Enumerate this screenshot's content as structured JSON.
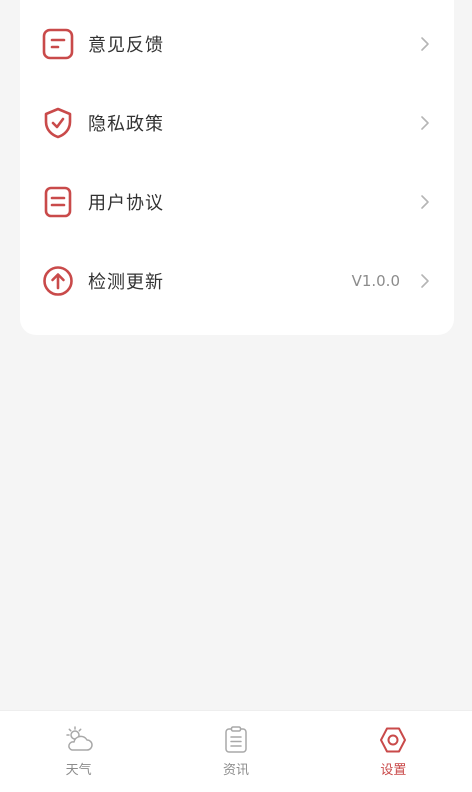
{
  "settings": {
    "items": [
      {
        "label": "意见反馈",
        "icon": "feedback-icon",
        "value": ""
      },
      {
        "label": "隐私政策",
        "icon": "shield-check-icon",
        "value": ""
      },
      {
        "label": "用户协议",
        "icon": "agreement-icon",
        "value": ""
      },
      {
        "label": "检测更新",
        "icon": "update-arrow-icon",
        "value": "V1.0.0"
      }
    ]
  },
  "tabbar": {
    "tabs": [
      {
        "label": "天气",
        "icon": "weather-icon",
        "active": false
      },
      {
        "label": "资讯",
        "icon": "news-clipboard-icon",
        "active": false
      },
      {
        "label": "设置",
        "icon": "settings-hexagon-icon",
        "active": true
      }
    ]
  },
  "colors": {
    "accent": "#c94a4a",
    "text": "#333333",
    "muted": "#8c8c8c",
    "background": "#f5f5f5"
  }
}
